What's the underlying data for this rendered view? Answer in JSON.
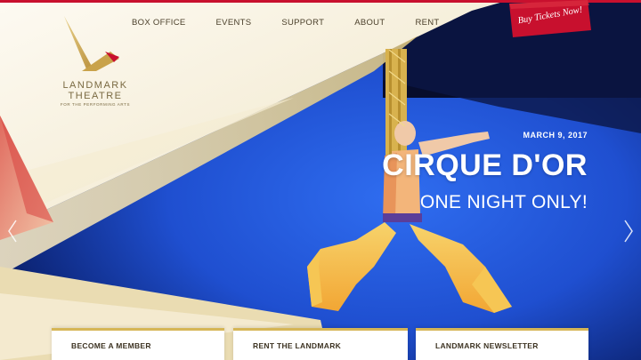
{
  "logo": {
    "line1": "LANDMARK",
    "line2": "THEATRE",
    "line3": "FOR THE PERFORMING ARTS"
  },
  "nav": {
    "items": [
      "BOX OFFICE",
      "EVENTS",
      "SUPPORT",
      "ABOUT",
      "RENT"
    ]
  },
  "ribbon": {
    "label": "Buy Tickets Now!"
  },
  "hero": {
    "date": "MARCH 9, 2017",
    "title": "CIRQUE D'OR",
    "subtitle": "ONE NIGHT ONLY!"
  },
  "cards": [
    {
      "label": "BECOME A MEMBER"
    },
    {
      "label": "RENT THE LANDMARK"
    },
    {
      "label": "LANDMARK NEWSLETTER"
    }
  ],
  "colors": {
    "accent_red": "#c8102e",
    "gold": "#d6b656",
    "stage_blue": "#1f4fd0"
  },
  "icons": {
    "prev": "chevron-left-icon",
    "next": "chevron-right-icon"
  }
}
